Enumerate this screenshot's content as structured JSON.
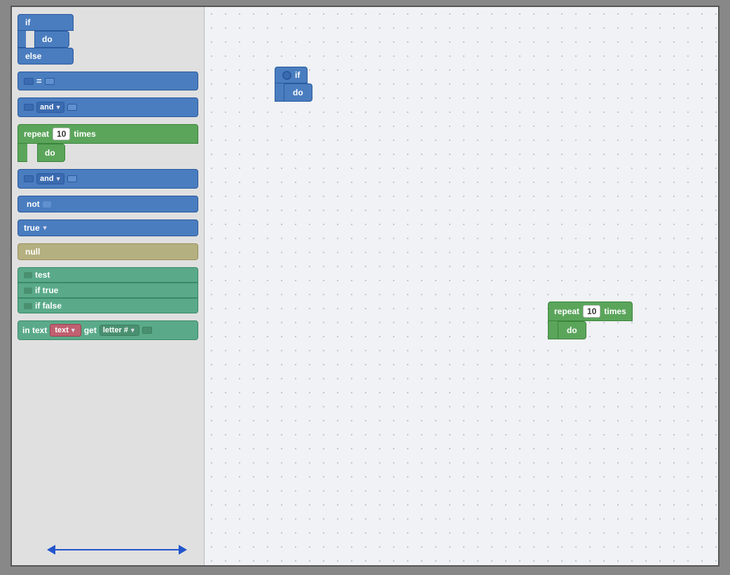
{
  "sidebar": {
    "blocks": {
      "if_block": {
        "if_label": "if",
        "do_label": "do",
        "else_label": "else"
      },
      "connector_block": {},
      "and_block_1": {
        "label": "and"
      },
      "repeat_block": {
        "repeat_label": "repeat",
        "times_label": "times",
        "num": "10",
        "do_label": "do"
      },
      "and_block_2": {
        "label": "and"
      },
      "not_block": {
        "label": "not"
      },
      "true_block": {
        "label": "true"
      },
      "null_block": {
        "label": "null"
      },
      "test_block": {
        "test_label": "test",
        "if_true_label": "if true",
        "if_false_label": "if false"
      },
      "intext_block": {
        "in_label": "in text",
        "text_label": "text",
        "get_label": "get",
        "letter_label": "letter #"
      }
    }
  },
  "canvas": {
    "if_block": {
      "if_label": "if",
      "do_label": "do"
    },
    "repeat_block": {
      "repeat_label": "repeat",
      "times_label": "times",
      "num": "10",
      "do_label": "do"
    }
  },
  "arrows": {
    "vertical": "↕",
    "horizontal": "↔"
  }
}
